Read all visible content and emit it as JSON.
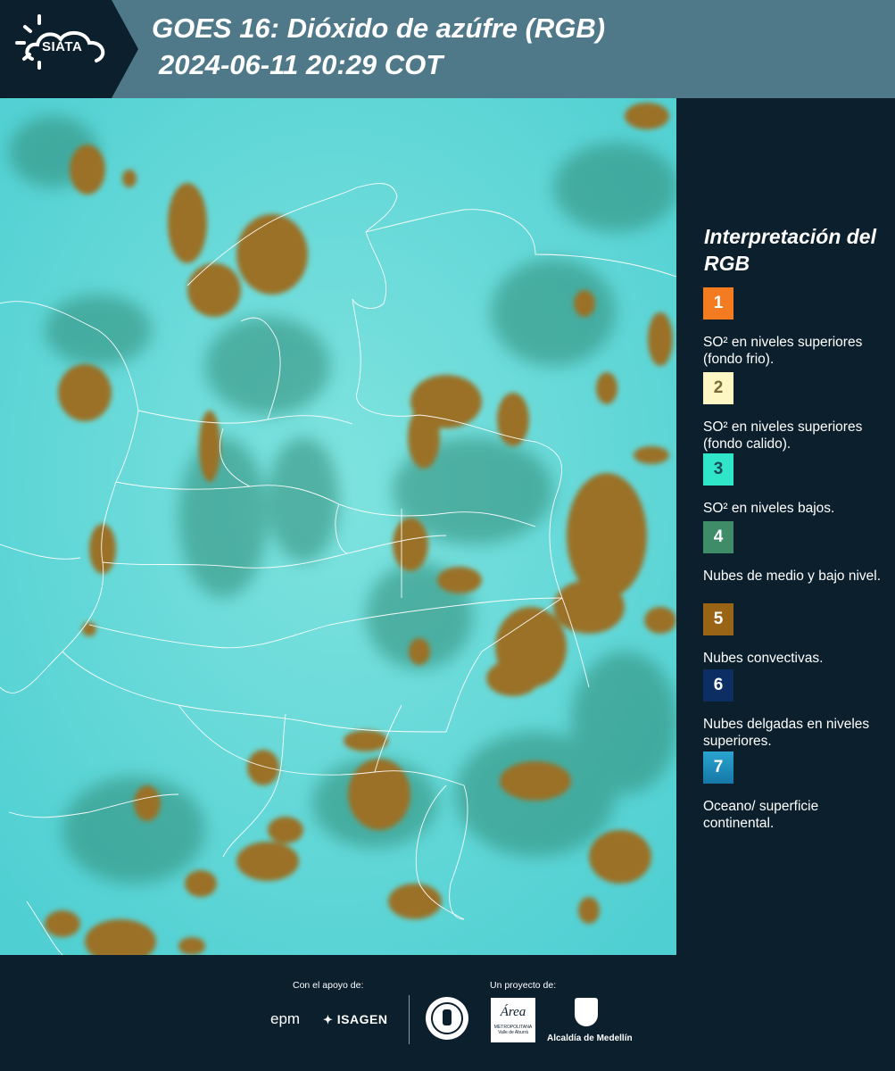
{
  "header": {
    "logo_text": "SIATA",
    "title_line1": "GOES 16: Dióxido de azúfre (RGB)",
    "title_line2": "2024-06-11 20:29 COT"
  },
  "legend": {
    "title": "Interpretación del RGB",
    "items": [
      {
        "number": "1",
        "label": "SO² en niveles superiores (fondo frio).",
        "color": "#f47b20",
        "text_color": "#ffffff"
      },
      {
        "number": "2",
        "label": "SO² en niveles superiores (fondo calido).",
        "color": "#fdf7c4",
        "text_color": "#7a6a3a"
      },
      {
        "number": "3",
        "label": "SO² en niveles bajos.",
        "color": "#2fe6c8",
        "text_color": "#1b4a57"
      },
      {
        "number": "4",
        "label": "Nubes de medio y bajo nivel.",
        "color": "#3f8c68",
        "text_color": "#ffffff"
      },
      {
        "number": "5",
        "label": "Nubes convectivas.",
        "color": "#9a6417",
        "text_color": "#ffffff"
      },
      {
        "number": "6",
        "label": "Nubes delgadas en niveles superiores.",
        "color": "#0d2e63",
        "text_color": "#ffffff"
      },
      {
        "number": "7",
        "label": "Oceano/ superficie continental.",
        "color": "#1e8fba",
        "text_color": "#ffffff"
      }
    ]
  },
  "footer": {
    "support_label": "Con el apoyo de:",
    "project_label": "Un proyecto de:",
    "sponsor1": "epm",
    "sponsor2": "ISAGEN",
    "partner_area_label": "Área",
    "partner_area_sub": "METROPOLITANA",
    "partner_area_sub2": "Valle de Aburrá",
    "partner_alcaldia": "Alcaldía de Medellín"
  },
  "colors": {
    "header_bg": "#4f7988",
    "panel_bg": "#0c1f2c",
    "map_background": "#5fdad6",
    "cloud_convective": "#9a7128",
    "cloud_mid_low": "#2f8a74"
  }
}
